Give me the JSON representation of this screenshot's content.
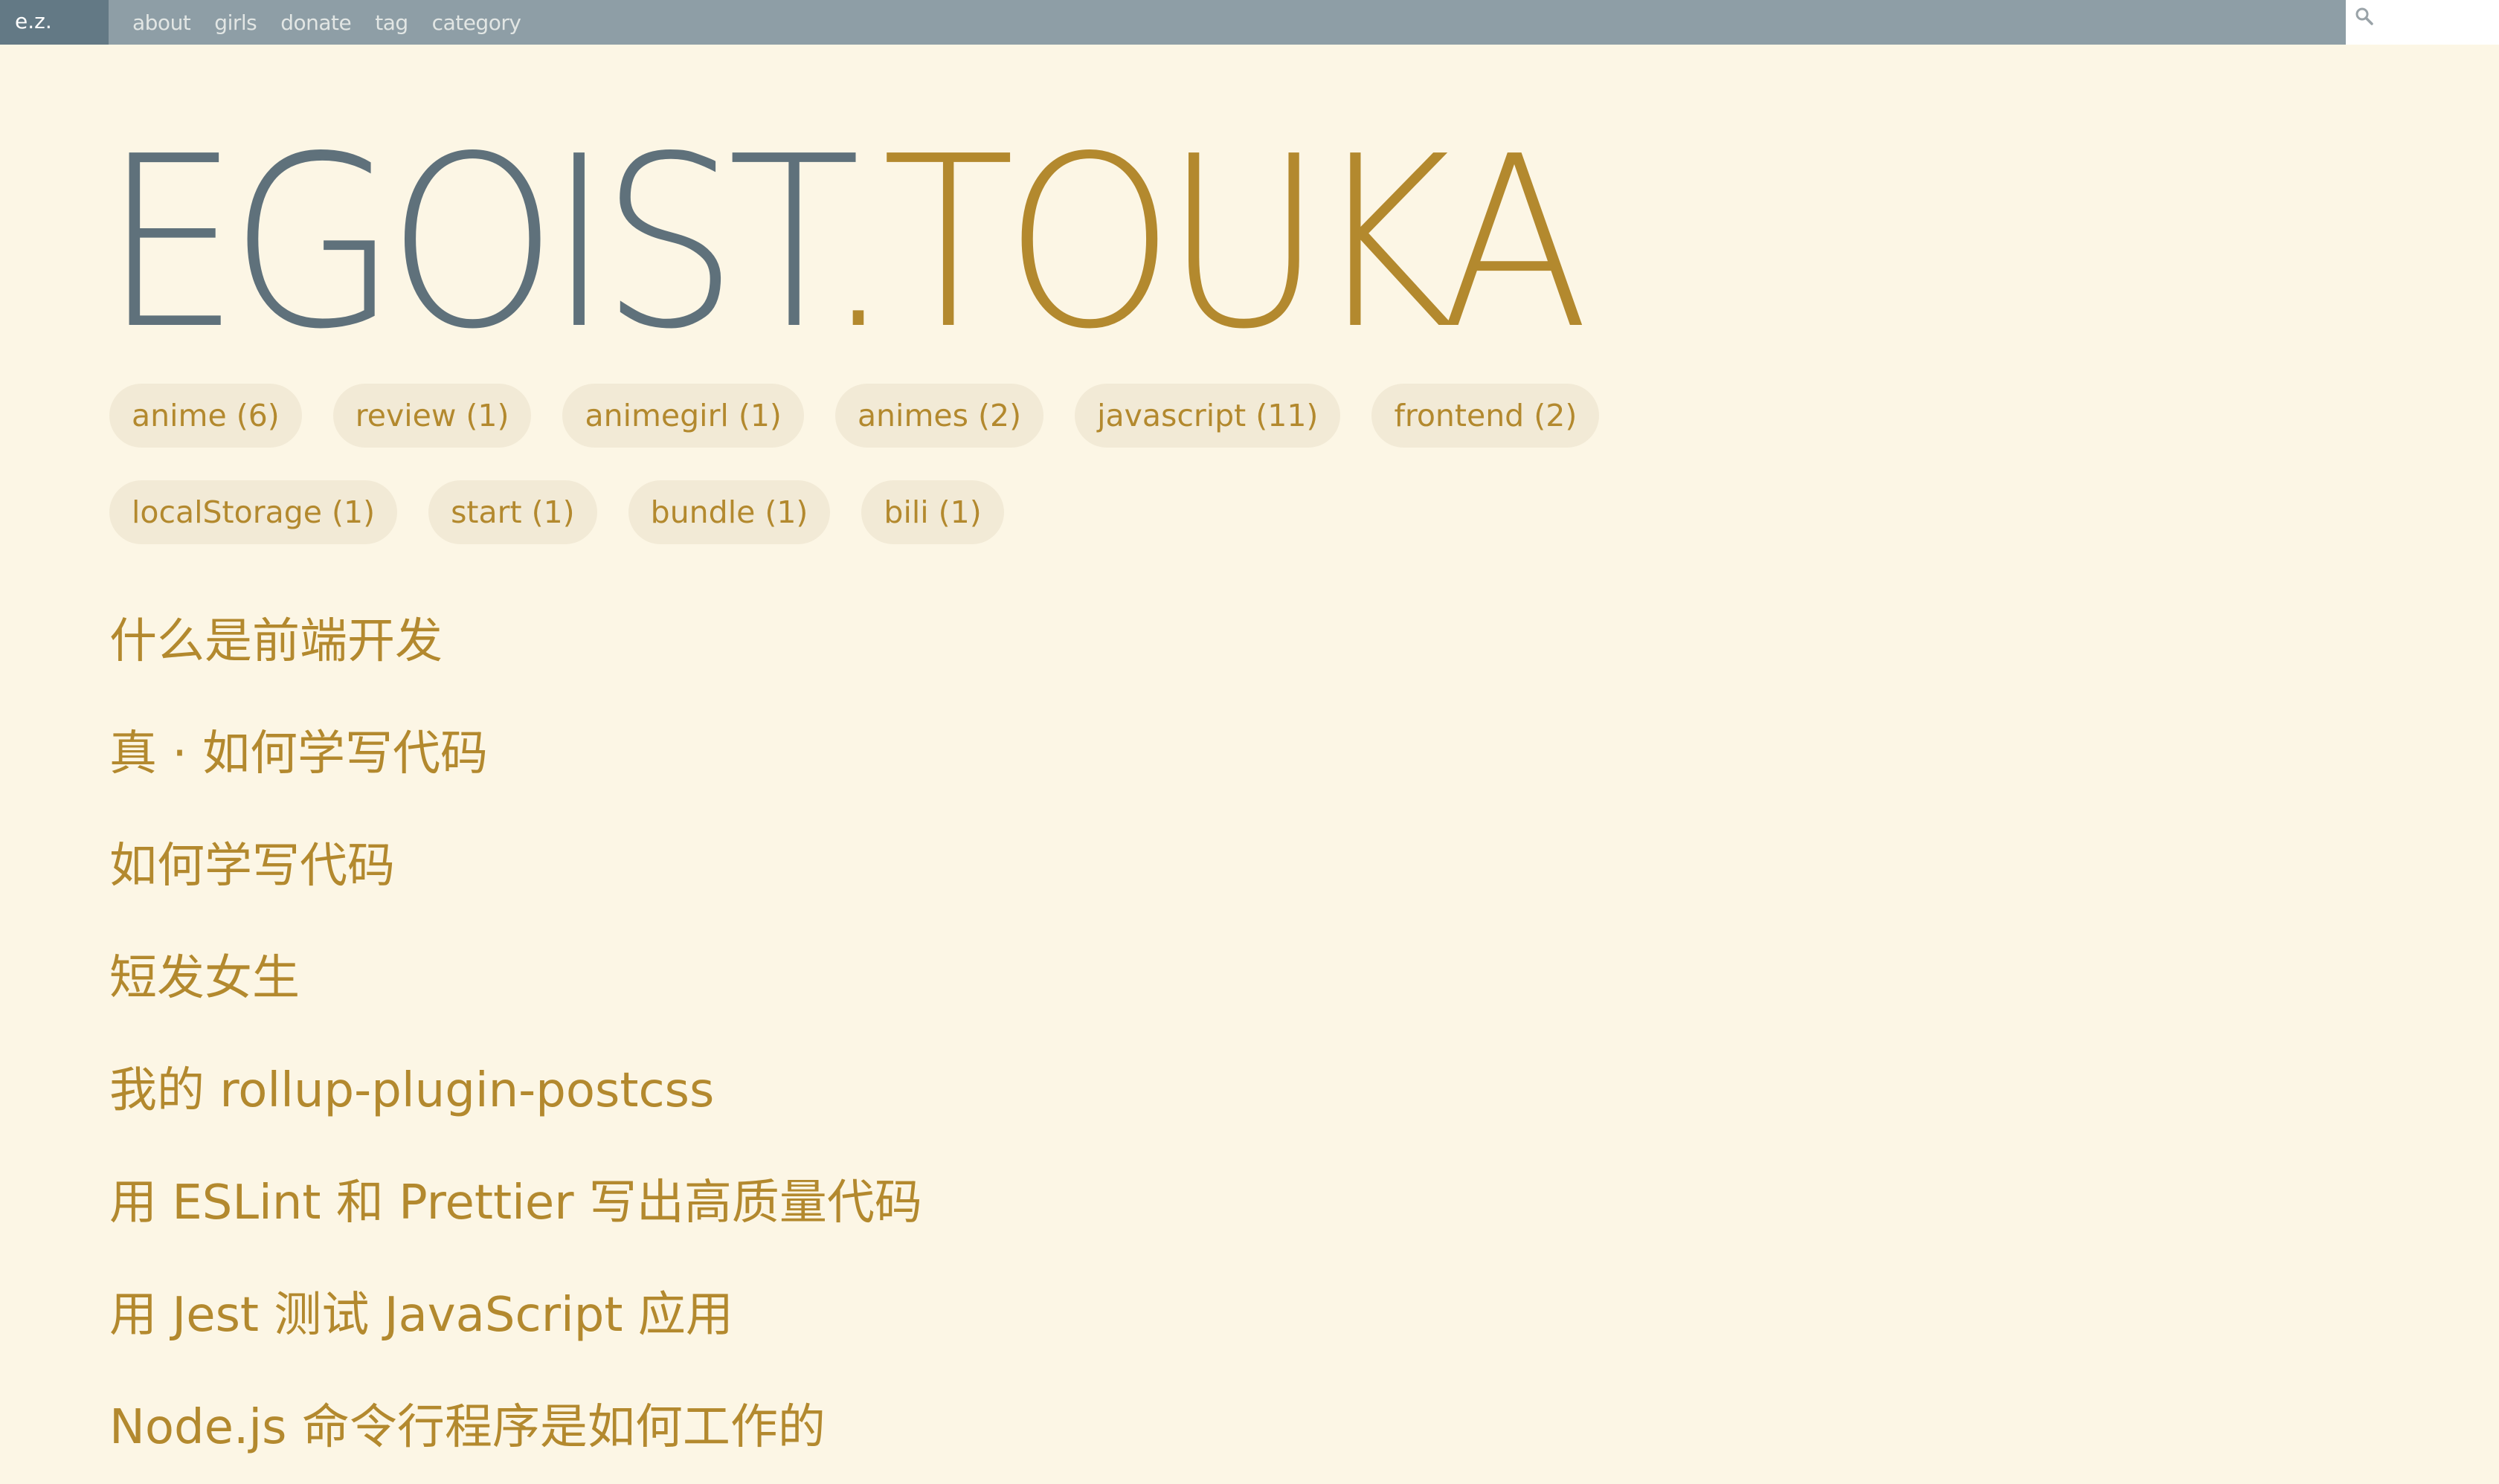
{
  "header": {
    "brand": "e.z.",
    "nav": [
      "about",
      "girls",
      "donate",
      "tag",
      "category"
    ],
    "search_placeholder": ""
  },
  "logo": {
    "part_a": "EGOIST",
    "part_b": ".TOUKA"
  },
  "tags": [
    [
      "anime (6)",
      "review (1)",
      "animegirl (1)",
      "animes (2)",
      "javascript (11)",
      "frontend (2)"
    ],
    [
      "localStorage (1)",
      "start (1)",
      "bundle (1)",
      "bili (1)"
    ]
  ],
  "posts": [
    "什么是前端开发",
    "真 · 如何学写代码",
    "如何学写代码",
    "短发女生",
    "我的 rollup-plugin-postcss",
    "用 ESLint 和 Prettier 写出高质量代码",
    "用 Jest 测试 JavaScript 应用",
    "Node.js 命令行程序是如何工作的"
  ],
  "colors": {
    "background": "#fcf6e5",
    "topbar": "#8e9ea6",
    "brand_bg": "#637985",
    "logo_dark": "#5f717b",
    "accent": "#b3892e",
    "tag_bg": "#f2ead6"
  },
  "icons": {
    "search": "search-icon"
  }
}
